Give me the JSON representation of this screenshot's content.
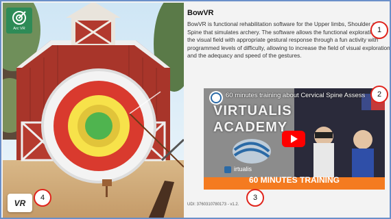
{
  "app": {
    "name": "BowVR",
    "logo_label": "Arc VR",
    "vr_button": "VR"
  },
  "description": "BowVR is functional rehabilitation software for the Upper limbs, Shoulder and Spine that simulates archery. The software allows the functional exploration of the visual field with appropriate gestural response through a fun activity with programmed levels of difficulty, allowing to increase the field of visual exploration and the adequacy and speed of the gestures.",
  "video": {
    "title": "60 minutes training about Cervical Spine Assess",
    "brand_line1": "VIRTUALIS",
    "brand_line2": "ACADEMY",
    "logo_text": "irtualis",
    "banner": "60 MINUTES TRAINING"
  },
  "udi": "UDI: 3760310780173 - v1.2.",
  "badges": [
    "1",
    "2",
    "3",
    "4"
  ],
  "colors": {
    "accent_red": "#e0241c",
    "logo_green": "#2e8b57",
    "banner_orange": "#f47b20",
    "frame_blue": "#6a8fc9"
  }
}
